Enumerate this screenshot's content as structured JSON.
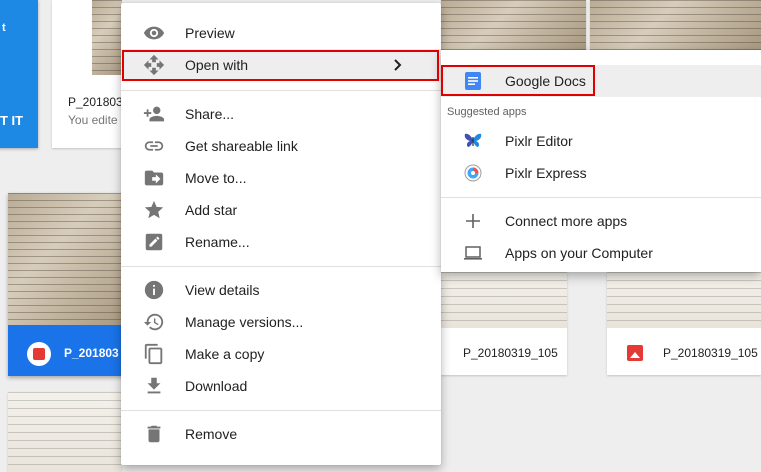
{
  "background": {
    "promo_top": "t",
    "promo_cta": "T IT",
    "card_top_title": "P_201803",
    "card_top_sub": "You edite",
    "sel_card_title": "P_201803",
    "card_mid_title": "P_20180319_105",
    "card_right_title": "P_20180319_105"
  },
  "context_menu": {
    "items": [
      {
        "label": "Preview",
        "icon": "eye-icon"
      },
      {
        "label": "Open with",
        "icon": "move-arrows-icon"
      },
      {
        "label": "Share...",
        "icon": "add-person-icon"
      },
      {
        "label": "Get shareable link",
        "icon": "link-icon"
      },
      {
        "label": "Move to...",
        "icon": "move-folder-icon"
      },
      {
        "label": "Add star",
        "icon": "star-icon"
      },
      {
        "label": "Rename...",
        "icon": "pencil-icon"
      },
      {
        "label": "View details",
        "icon": "info-icon"
      },
      {
        "label": "Manage versions...",
        "icon": "history-icon"
      },
      {
        "label": "Make a copy",
        "icon": "copy-icon"
      },
      {
        "label": "Download",
        "icon": "download-icon"
      },
      {
        "label": "Remove",
        "icon": "trash-icon"
      }
    ]
  },
  "submenu": {
    "google_docs": "Google Docs",
    "section_label": "Suggested apps",
    "apps": [
      {
        "label": "Pixlr Editor",
        "icon": "butterfly-icon"
      },
      {
        "label": "Pixlr Express",
        "icon": "pixlr-express-icon"
      }
    ],
    "connect_more": "Connect more apps",
    "apps_on_computer": "Apps on your Computer"
  },
  "colors": {
    "highlight_box": "#e00000",
    "selection_blue": "#1a73e8",
    "docs_blue": "#4285f4"
  }
}
